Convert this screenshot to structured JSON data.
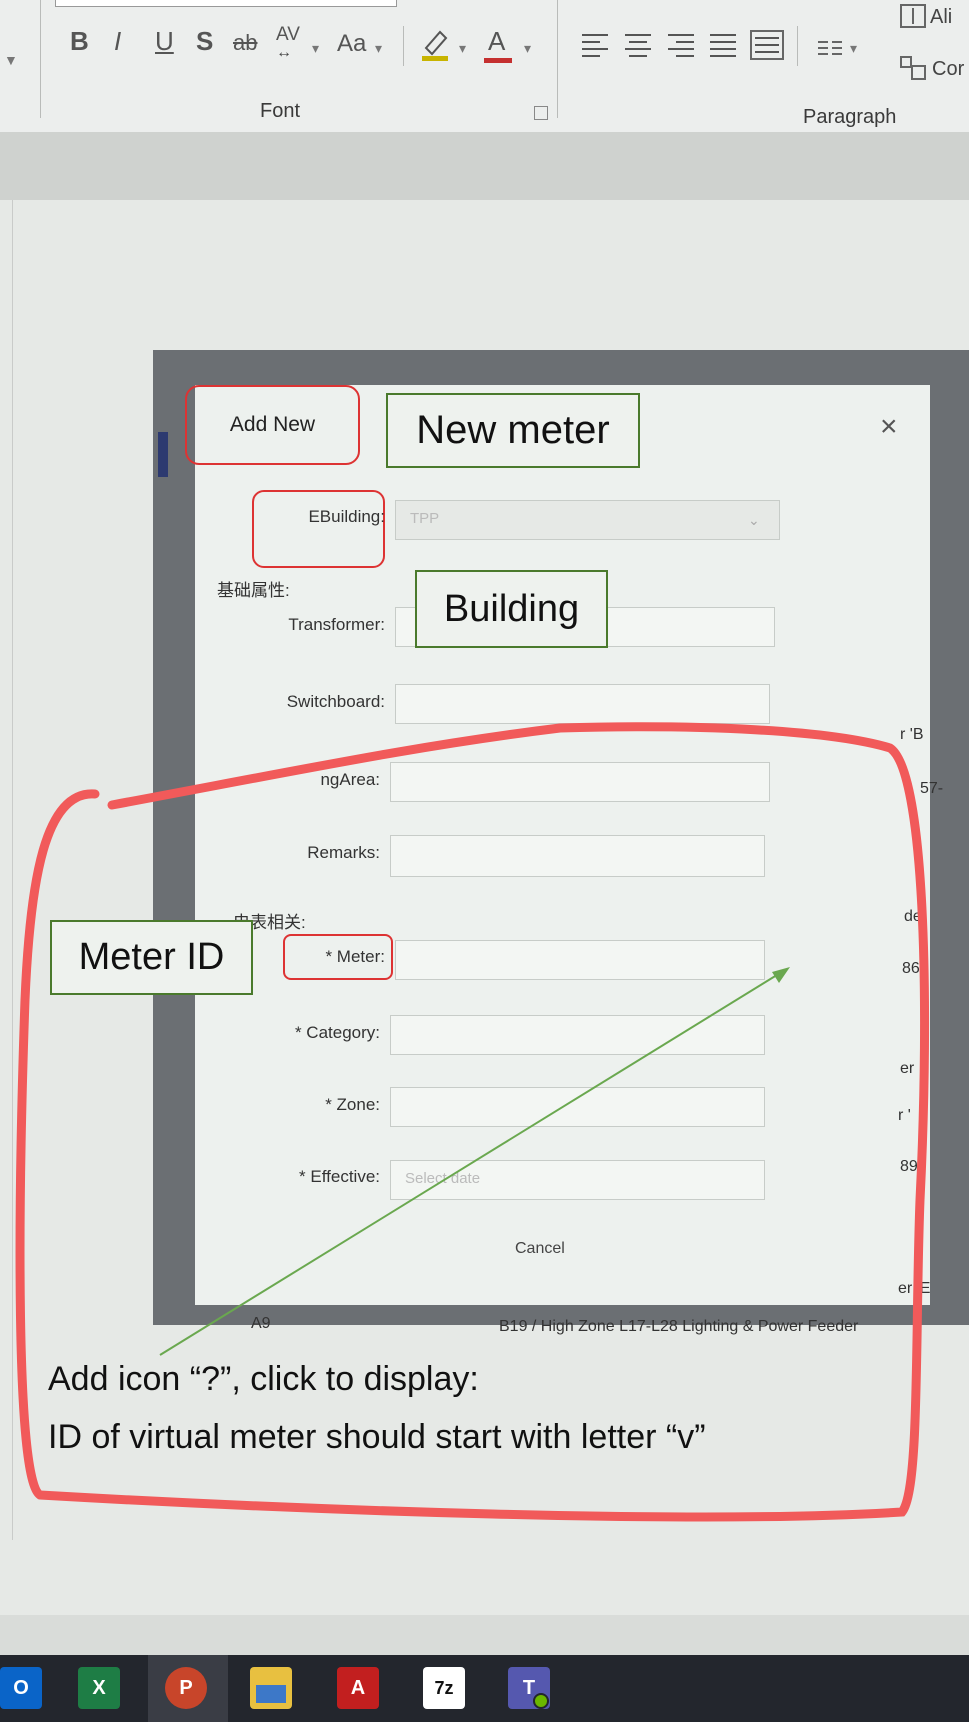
{
  "ribbon": {
    "font_group_label": "Font",
    "paragraph_group_label": "Paragraph",
    "buttons": {
      "bold": "B",
      "italic": "I",
      "underline": "U",
      "shadow": "S",
      "strikethrough": "ab",
      "char_spacing": "AV",
      "change_case": "Aa",
      "font_color": "A"
    },
    "align_text_label": "Ali",
    "convert_label": "Cor"
  },
  "dialog": {
    "add_new_label": "Add New",
    "title_callout": "New meter",
    "close_symbol": "×",
    "fields": {
      "ebuilding_label": "EBuilding:",
      "ebuilding_value": "TPP",
      "section_basic": "基础属性:",
      "transformer_label": "Transformer:",
      "switchboard_label": "Switchboard:",
      "servingarea_label": "ngArea:",
      "remarks_label": "Remarks:",
      "section_meter": "电表相关:",
      "meter_label": "* Meter:",
      "category_label": "* Category:",
      "zone_label": "* Zone:",
      "effective_label": "* Effective:",
      "effective_placeholder": "Select date"
    },
    "cancel_label": "Cancel",
    "building_callout": "Building",
    "meter_id_callout": "Meter ID",
    "status_left": "A9",
    "status_right": "B19 / High Zone L17-L28 Lighting & Power Feeder",
    "edge_fragments": [
      "r 'B",
      "57-",
      "de",
      "86",
      "er",
      "r '",
      "89",
      "er 'E"
    ]
  },
  "annotation": {
    "note_line1": "Add icon “?”, click to display:",
    "note_line2": "ID of virtual meter should start with letter “v”",
    "circle_color": "#f15a5a",
    "arrow_color": "#6aa84f"
  },
  "taskbar": {
    "apps": [
      "outlook-icon",
      "excel-icon",
      "powerpoint-icon",
      "file-explorer-icon",
      "acrobat-icon",
      "7zip-icon",
      "teams-icon"
    ],
    "labels": {
      "outlook": "O",
      "excel": "X",
      "powerpoint": "P",
      "acrobat": "A",
      "sevenzip": "7z",
      "teams": "T"
    }
  }
}
